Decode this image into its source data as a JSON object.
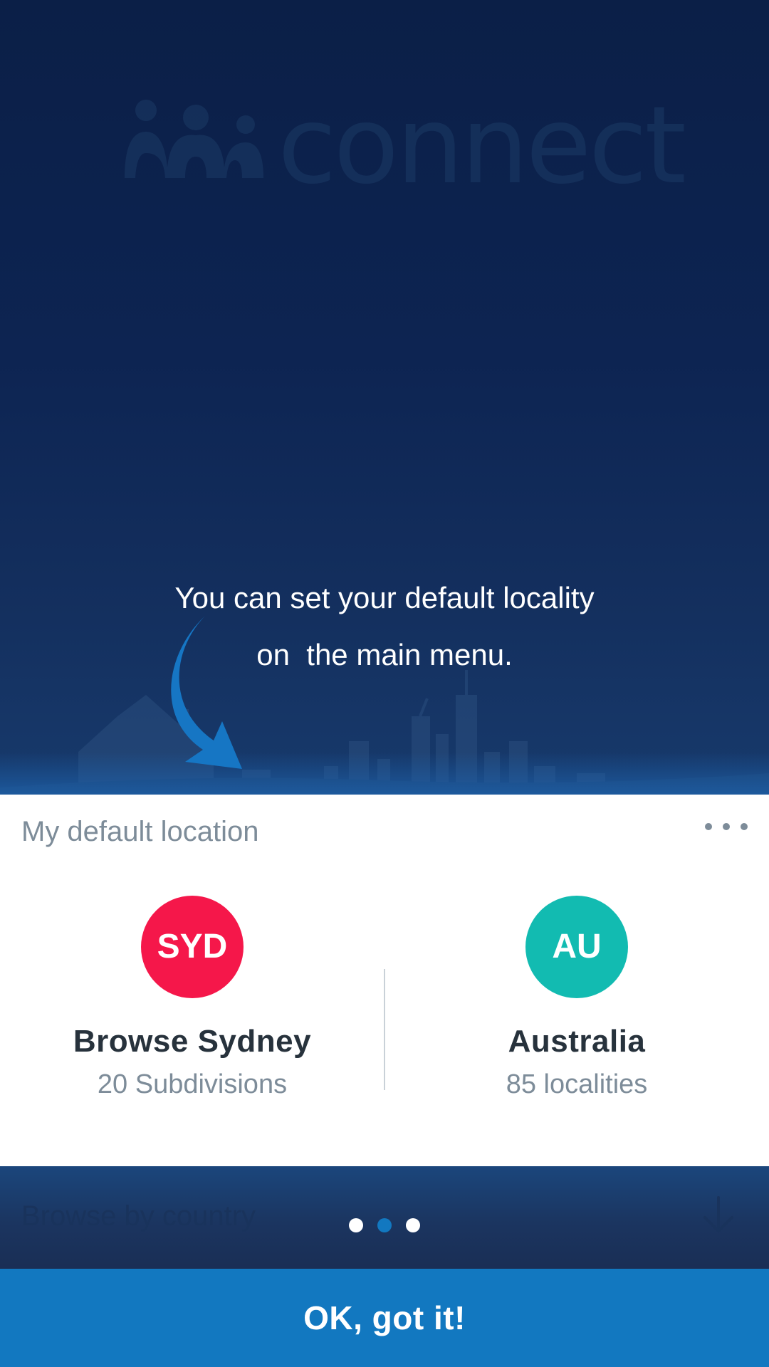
{
  "logo": {
    "text": "connect"
  },
  "tip": {
    "line1": "You can set your default locality",
    "line2": "on  the main menu."
  },
  "card": {
    "title": "My default location",
    "more_icon": "more-horizontal-icon",
    "left": {
      "badge": "SYD",
      "badge_color": "#f5174a",
      "name": "Browse Sydney",
      "subtitle": "20 Subdivisions"
    },
    "right": {
      "badge": "AU",
      "badge_color": "#12bbb1",
      "name": "Australia",
      "subtitle": "85 localities"
    }
  },
  "behind": {
    "label": "Browse by country",
    "icon": "arrow-down-icon"
  },
  "pager": {
    "total": 3,
    "active_index": 1,
    "active_color": "#1278c0",
    "inactive_color": "#ffffff"
  },
  "button": {
    "label": "OK, got it!"
  },
  "colors": {
    "accent": "#1278c0",
    "background": "#0d2148",
    "muted_text": "#7d8c99"
  }
}
